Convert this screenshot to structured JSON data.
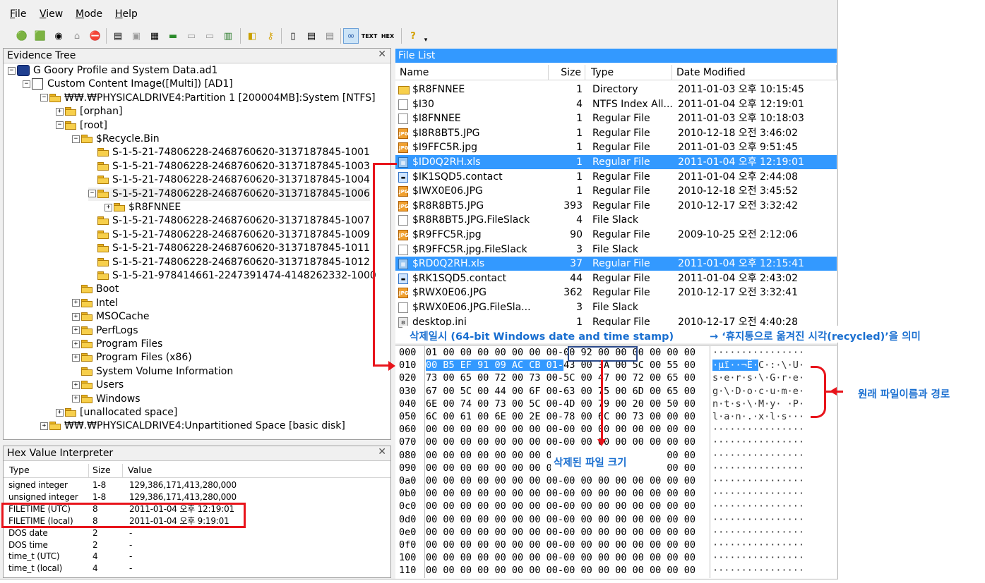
{
  "menu": {
    "items": [
      {
        "label": "File",
        "key": "F"
      },
      {
        "label": "View",
        "key": "V"
      },
      {
        "label": "Mode",
        "key": "M"
      },
      {
        "label": "Help",
        "key": "H"
      }
    ]
  },
  "toolbar": {
    "icons": [
      "add-evidence-icon",
      "add-image-icon",
      "open-case-icon",
      "remove-evidence-icon",
      "save-case-icon",
      "disk-icon",
      "save-icon",
      "floppy-icon",
      "export-icon",
      "print-icon",
      "drive-icon",
      "memory-icon",
      "report-icon",
      "key-icon",
      "new-page-icon",
      "text-page-icon",
      "copy-page-icon",
      "hex-compare-icon",
      "text-view-icon",
      "hex-view-icon",
      "help-icon",
      "dropdown-icon"
    ],
    "text_view_label": "TEXT",
    "hex_view_label": "HEX"
  },
  "evidence_tree": {
    "title": "Evidence Tree",
    "rows": [
      {
        "label": "G Goory Profile and System Data.ad1",
        "level": 0,
        "exp": "-",
        "icon": "case"
      },
      {
        "label": "Custom Content Image([Multi]) [AD1]",
        "level": 1,
        "exp": "-",
        "icon": "image"
      },
      {
        "label": "₩₩.₩PHYSICALDRIVE4:Partition 1 [200004MB]:System [NTFS]",
        "level": 2,
        "exp": "-",
        "icon": "folder"
      },
      {
        "label": "[orphan]",
        "level": 3,
        "exp": "+",
        "icon": "folder"
      },
      {
        "label": "[root]",
        "level": 3,
        "exp": "-",
        "icon": "folder"
      },
      {
        "label": "$Recycle.Bin",
        "level": 4,
        "exp": "-",
        "icon": "folder"
      },
      {
        "label": "S-1-5-21-74806228-2468760620-3137187845-1001",
        "level": 5,
        "exp": "",
        "icon": "folder"
      },
      {
        "label": "S-1-5-21-74806228-2468760620-3137187845-1003",
        "level": 5,
        "exp": "",
        "icon": "folder"
      },
      {
        "label": "S-1-5-21-74806228-2468760620-3137187845-1004",
        "level": 5,
        "exp": "",
        "icon": "folder"
      },
      {
        "label": "S-1-5-21-74806228-2468760620-3137187845-1006",
        "level": 5,
        "exp": "-",
        "icon": "folder",
        "selected": true
      },
      {
        "label": "$R8FNNEE",
        "level": 6,
        "exp": "+",
        "icon": "folder"
      },
      {
        "label": "S-1-5-21-74806228-2468760620-3137187845-1007",
        "level": 5,
        "exp": "",
        "icon": "folder"
      },
      {
        "label": "S-1-5-21-74806228-2468760620-3137187845-1009",
        "level": 5,
        "exp": "",
        "icon": "folder"
      },
      {
        "label": "S-1-5-21-74806228-2468760620-3137187845-1011",
        "level": 5,
        "exp": "",
        "icon": "folder"
      },
      {
        "label": "S-1-5-21-74806228-2468760620-3137187845-1012",
        "level": 5,
        "exp": "",
        "icon": "folder"
      },
      {
        "label": "S-1-5-21-978414661-2247391474-4148262332-1000",
        "level": 5,
        "exp": "",
        "icon": "folder"
      },
      {
        "label": "Boot",
        "level": 4,
        "exp": "",
        "icon": "folder"
      },
      {
        "label": "Intel",
        "level": 4,
        "exp": "+",
        "icon": "folder"
      },
      {
        "label": "MSOCache",
        "level": 4,
        "exp": "+",
        "icon": "folder"
      },
      {
        "label": "PerfLogs",
        "level": 4,
        "exp": "+",
        "icon": "folder"
      },
      {
        "label": "Program Files",
        "level": 4,
        "exp": "+",
        "icon": "folder"
      },
      {
        "label": "Program Files (x86)",
        "level": 4,
        "exp": "+",
        "icon": "folder"
      },
      {
        "label": "System Volume Information",
        "level": 4,
        "exp": "",
        "icon": "folder"
      },
      {
        "label": "Users",
        "level": 4,
        "exp": "+",
        "icon": "folder"
      },
      {
        "label": "Windows",
        "level": 4,
        "exp": "+",
        "icon": "folder"
      },
      {
        "label": "[unallocated space]",
        "level": 3,
        "exp": "+",
        "icon": "folder"
      },
      {
        "label": "₩₩.₩PHYSICALDRIVE4:Unpartitioned Space [basic disk]",
        "level": 2,
        "exp": "+",
        "icon": "folder"
      }
    ]
  },
  "file_list": {
    "title": "File List",
    "columns": [
      "Name",
      "Size",
      "Type",
      "Date Modified"
    ],
    "rows": [
      {
        "name": "$R8FNNEE",
        "size": "1",
        "type": "Directory",
        "date": "2011-01-03 오후 10:15:45",
        "icon": "folder"
      },
      {
        "name": "$I30",
        "size": "4",
        "type": "NTFS Index All...",
        "date": "2011-01-04 오후 12:19:01",
        "icon": "doc"
      },
      {
        "name": "$I8FNNEE",
        "size": "1",
        "type": "Regular File",
        "date": "2011-01-03 오후 10:18:03",
        "icon": "doc"
      },
      {
        "name": "$I8R8BT5.JPG",
        "size": "1",
        "type": "Regular File",
        "date": "2010-12-18 오전 3:46:02",
        "icon": "jpg"
      },
      {
        "name": "$I9FFC5R.jpg",
        "size": "1",
        "type": "Regular File",
        "date": "2011-01-03 오후 9:51:45",
        "icon": "jpg"
      },
      {
        "name": "$ID0Q2RH.xls",
        "size": "1",
        "type": "Regular File",
        "date": "2011-01-04 오후 12:19:01",
        "icon": "xls",
        "selected": true
      },
      {
        "name": "$IK1SQD5.contact",
        "size": "1",
        "type": "Regular File",
        "date": "2011-01-04 오후 2:44:08",
        "icon": "contact"
      },
      {
        "name": "$IWX0E06.JPG",
        "size": "1",
        "type": "Regular File",
        "date": "2010-12-18 오전 3:45:52",
        "icon": "jpg"
      },
      {
        "name": "$R8R8BT5.JPG",
        "size": "393",
        "type": "Regular File",
        "date": "2010-12-17 오전 3:32:42",
        "icon": "jpg"
      },
      {
        "name": "$R8R8BT5.JPG.FileSlack",
        "size": "4",
        "type": "File Slack",
        "date": "",
        "icon": "doc"
      },
      {
        "name": "$R9FFC5R.jpg",
        "size": "90",
        "type": "Regular File",
        "date": "2009-10-25 오전 2:12:06",
        "icon": "jpg"
      },
      {
        "name": "$R9FFC5R.jpg.FileSlack",
        "size": "3",
        "type": "File Slack",
        "date": "",
        "icon": "doc"
      },
      {
        "name": "$RD0Q2RH.xls",
        "size": "37",
        "type": "Regular File",
        "date": "2011-01-04 오후 12:15:41",
        "icon": "xls",
        "selected": true
      },
      {
        "name": "$RK1SQD5.contact",
        "size": "44",
        "type": "Regular File",
        "date": "2011-01-04 오후 2:43:02",
        "icon": "contact"
      },
      {
        "name": "$RWX0E06.JPG",
        "size": "362",
        "type": "Regular File",
        "date": "2010-12-17 오전 3:32:41",
        "icon": "jpg"
      },
      {
        "name": "$RWX0E06.JPG.FileSla...",
        "size": "3",
        "type": "File Slack",
        "date": "",
        "icon": "doc"
      },
      {
        "name": "desktop.ini",
        "size": "1",
        "type": "Regular File",
        "date": "2010-12-17 오전 4:40:28",
        "icon": "ini"
      }
    ]
  },
  "hex_view": {
    "rows": [
      {
        "off": "000",
        "bytes": "01 00 00 00 00 00 00 00-00 92 00 00 00 00 00 00",
        "ascii": "················"
      },
      {
        "off": "010",
        "bytes": "00 B5 EF 91 09 AC CB 01-43 00 3A 00 5C 00 55 00",
        "ascii": "·µï··¬Ë·C·:·\\·U·"
      },
      {
        "off": "020",
        "bytes": "73 00 65 00 72 00 73 00-5C 00 47 00 72 00 65 00",
        "ascii": "s·e·r·s·\\·G·r·e·"
      },
      {
        "off": "030",
        "bytes": "67 00 5C 00 44 00 6F 00-63 00 75 00 6D 00 65 00",
        "ascii": "g·\\·D·o·c·u·m·e·"
      },
      {
        "off": "040",
        "bytes": "6E 00 74 00 73 00 5C 00-4D 00 79 00 20 00 50 00",
        "ascii": "n·t·s·\\·M·y· ·P·"
      },
      {
        "off": "050",
        "bytes": "6C 00 61 00 6E 00 2E 00-78 00 6C 00 73 00 00 00",
        "ascii": "l·a·n·.·x·l·s···"
      },
      {
        "off": "060",
        "bytes": "00 00 00 00 00 00 00 00-00 00 00 00 00 00 00 00",
        "ascii": "················"
      },
      {
        "off": "070",
        "bytes": "00 00 00 00 00 00 00 00-00 00 00 00 00 00 00 00",
        "ascii": "················"
      },
      {
        "off": "080",
        "bytes": "00 00 00 00 00 00 00 00-00 00 00 00 00 00 00 00",
        "ascii": "················"
      },
      {
        "off": "090",
        "bytes": "00 00 00 00 00 00 00 00-00 00 00 00 00 00 00 00",
        "ascii": "················"
      },
      {
        "off": "0a0",
        "bytes": "00 00 00 00 00 00 00 00-00 00 00 00 00 00 00 00",
        "ascii": "················"
      },
      {
        "off": "0b0",
        "bytes": "00 00 00 00 00 00 00 00-00 00 00 00 00 00 00 00",
        "ascii": "················"
      },
      {
        "off": "0c0",
        "bytes": "00 00 00 00 00 00 00 00-00 00 00 00 00 00 00 00",
        "ascii": "················"
      },
      {
        "off": "0d0",
        "bytes": "00 00 00 00 00 00 00 00-00 00 00 00 00 00 00 00",
        "ascii": "················"
      },
      {
        "off": "0e0",
        "bytes": "00 00 00 00 00 00 00 00-00 00 00 00 00 00 00 00",
        "ascii": "················"
      },
      {
        "off": "0f0",
        "bytes": "00 00 00 00 00 00 00 00-00 00 00 00 00 00 00 00",
        "ascii": "················"
      },
      {
        "off": "100",
        "bytes": "00 00 00 00 00 00 00 00-00 00 00 00 00 00 00 00",
        "ascii": "················"
      },
      {
        "off": "110",
        "bytes": "00 00 00 00 00 00 00 00-00 00 00 00 00 00 00 00",
        "ascii": "················"
      }
    ]
  },
  "hex_value_interpreter": {
    "title": "Hex Value Interpreter",
    "columns": [
      "Type",
      "Size",
      "Value"
    ],
    "rows": [
      {
        "type": "signed integer",
        "size": "1-8",
        "value": "129,386,171,413,280,000"
      },
      {
        "type": "unsigned integer",
        "size": "1-8",
        "value": "129,386,171,413,280,000"
      },
      {
        "type": "FILETIME (UTC)",
        "size": "8",
        "value": "2011-01-04 오후 12:19:01"
      },
      {
        "type": "FILETIME (local)",
        "size": "8",
        "value": "2011-01-04 오후 9:19:01"
      },
      {
        "type": "DOS date",
        "size": "2",
        "value": "-"
      },
      {
        "type": "DOS time",
        "size": "2",
        "value": "-"
      },
      {
        "type": "time_t (UTC)",
        "size": "4",
        "value": "-"
      },
      {
        "type": "time_t (local)",
        "size": "4",
        "value": "-"
      }
    ]
  },
  "annotations": {
    "deleted_time": "삭제일시 (64-bit Windows date and time stamp)",
    "deleted_time_meaning": "→ ‘휴지통으로 옮겨진 시각(recycled)’을 의미",
    "original_path": "원래 파일이름과 경로",
    "deleted_size": "삭제된 파일 크기"
  },
  "colors": {
    "selection": "#3399ff",
    "annotation_red": "#e8141b",
    "annotation_blue": "#1a6fd0",
    "hex_box": "#2b4a8a"
  }
}
